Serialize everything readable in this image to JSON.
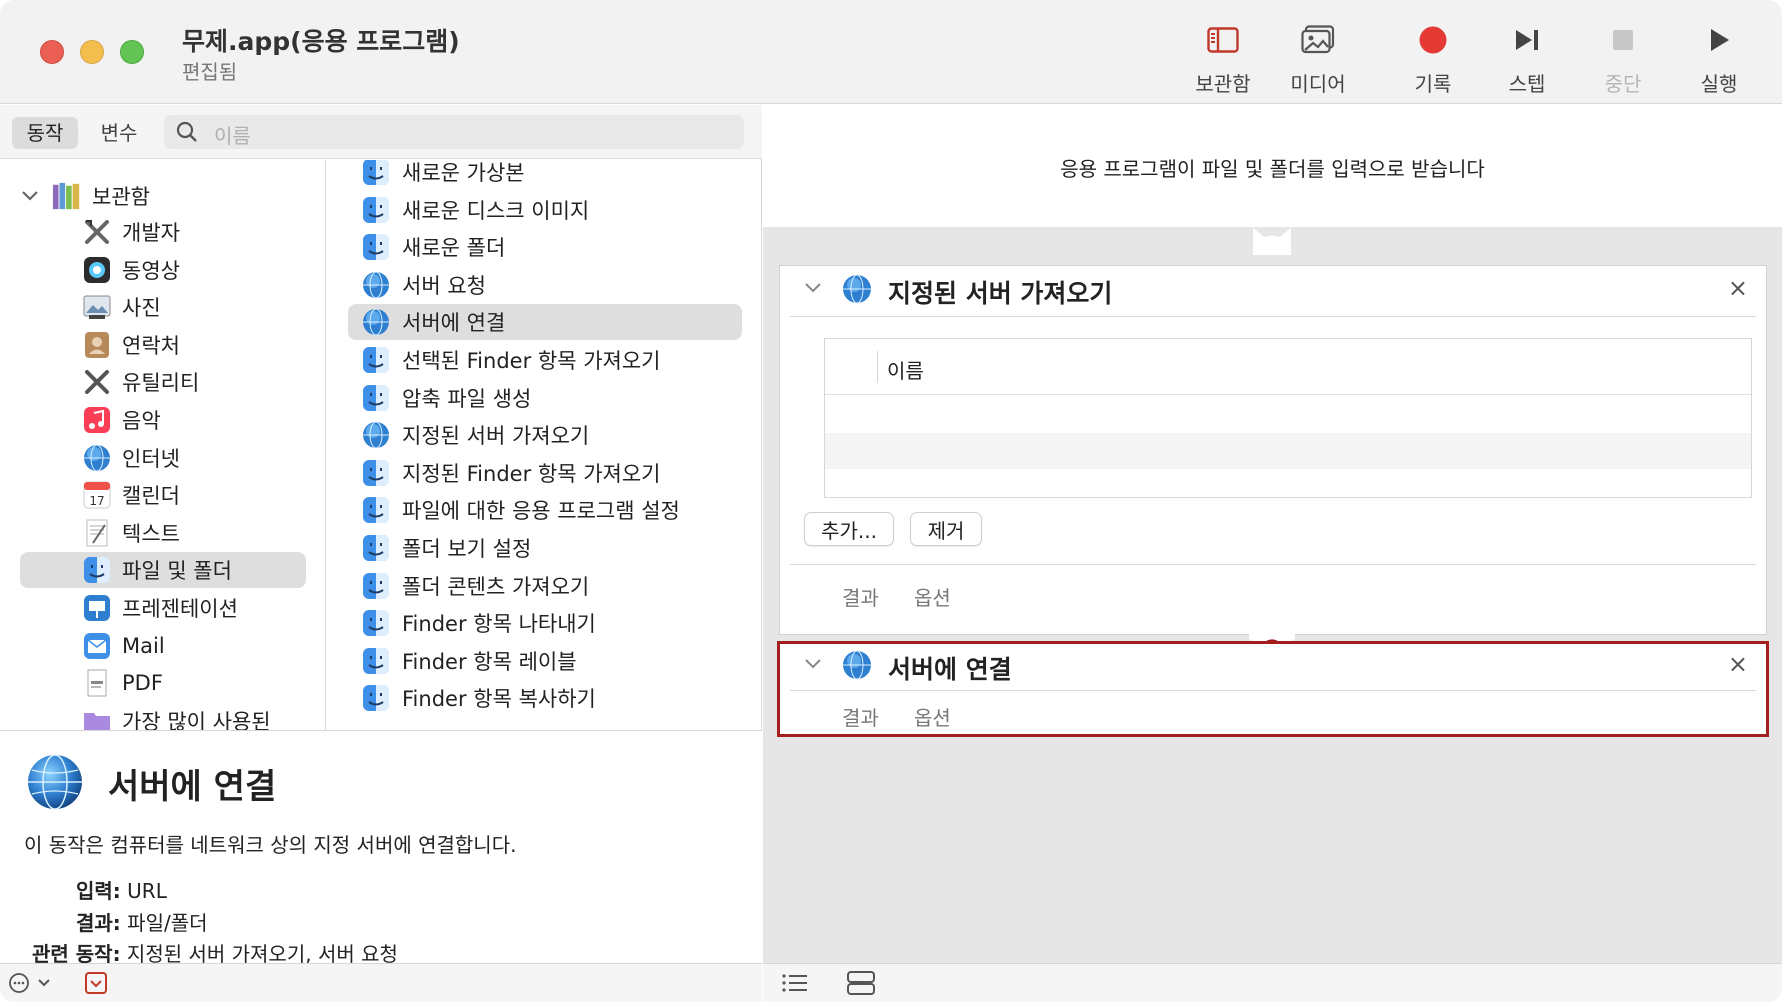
{
  "window": {
    "title": "무제.app(응용 프로그램)",
    "subtitle": "편집됨"
  },
  "toolbar": {
    "library_label": "보관함",
    "media_label": "미디어",
    "record_label": "기록",
    "step_label": "스텝",
    "stop_label": "중단",
    "run_label": "실행"
  },
  "search": {
    "tab_actions": "동작",
    "tab_variables": "변수",
    "placeholder": "이름"
  },
  "library": {
    "root": "보관함",
    "items": [
      {
        "label": "개발자",
        "icon": "developer-icon"
      },
      {
        "label": "동영상",
        "icon": "movies-icon"
      },
      {
        "label": "사진",
        "icon": "photos-icon"
      },
      {
        "label": "연락처",
        "icon": "contacts-icon"
      },
      {
        "label": "유틸리티",
        "icon": "utilities-icon"
      },
      {
        "label": "음악",
        "icon": "music-icon"
      },
      {
        "label": "인터넷",
        "icon": "internet-icon"
      },
      {
        "label": "캘린더",
        "icon": "calendar-icon"
      },
      {
        "label": "텍스트",
        "icon": "text-icon"
      },
      {
        "label": "파일 및 폴더",
        "icon": "finder-icon"
      },
      {
        "label": "프레젠테이션",
        "icon": "presentation-icon"
      },
      {
        "label": "Mail",
        "icon": "mail-icon"
      },
      {
        "label": "PDF",
        "icon": "pdf-icon"
      },
      {
        "label": "가장 많이 사용된",
        "icon": "folder-icon"
      }
    ],
    "selected_index": 9
  },
  "actions": {
    "items": [
      {
        "label": "새로운 가상본",
        "icon": "finder-icon"
      },
      {
        "label": "새로운 디스크 이미지",
        "icon": "finder-icon"
      },
      {
        "label": "새로운 폴더",
        "icon": "finder-icon"
      },
      {
        "label": "서버 요청",
        "icon": "globe-icon"
      },
      {
        "label": "서버에 연결",
        "icon": "globe-icon"
      },
      {
        "label": "선택된 Finder 항목 가져오기",
        "icon": "finder-icon"
      },
      {
        "label": "압축 파일 생성",
        "icon": "finder-icon"
      },
      {
        "label": "지정된 서버 가져오기",
        "icon": "globe-icon"
      },
      {
        "label": "지정된 Finder 항목 가져오기",
        "icon": "finder-icon"
      },
      {
        "label": "파일에 대한 응용 프로그램 설정",
        "icon": "finder-icon"
      },
      {
        "label": "폴더 보기 설정",
        "icon": "finder-icon"
      },
      {
        "label": "폴더 콘텐츠 가져오기",
        "icon": "finder-icon"
      },
      {
        "label": "Finder 항목 나타내기",
        "icon": "finder-icon"
      },
      {
        "label": "Finder 항목 레이블",
        "icon": "finder-icon"
      },
      {
        "label": "Finder 항목 복사하기",
        "icon": "finder-icon"
      }
    ],
    "selected_index": 4
  },
  "description": {
    "title": "서버에 연결",
    "text": "이 동작은 컴퓨터를 네트워크 상의 지정 서버에 연결합니다.",
    "input_key": "입력:",
    "input_value": "URL",
    "result_key": "결과:",
    "result_value": "파일/폴더",
    "related_key": "관련 동작:",
    "related_value": "지정된 서버 가져오기, 서버 요청"
  },
  "workflow": {
    "header": "응용 프로그램이 파일 및 폴더를 입력으로 받습니다",
    "card1": {
      "title": "지정된 서버 가져오기",
      "column_name": "이름",
      "add_button": "추가...",
      "remove_button": "제거",
      "tab_results": "결과",
      "tab_options": "옵션",
      "close": "×"
    },
    "card2": {
      "title": "서버에 연결",
      "tab_results": "결과",
      "tab_options": "옵션",
      "close": "×"
    }
  },
  "colors": {
    "accent_red": "#e53935",
    "selected_border": "#a31f1f",
    "selection_bg": "#dedede"
  }
}
